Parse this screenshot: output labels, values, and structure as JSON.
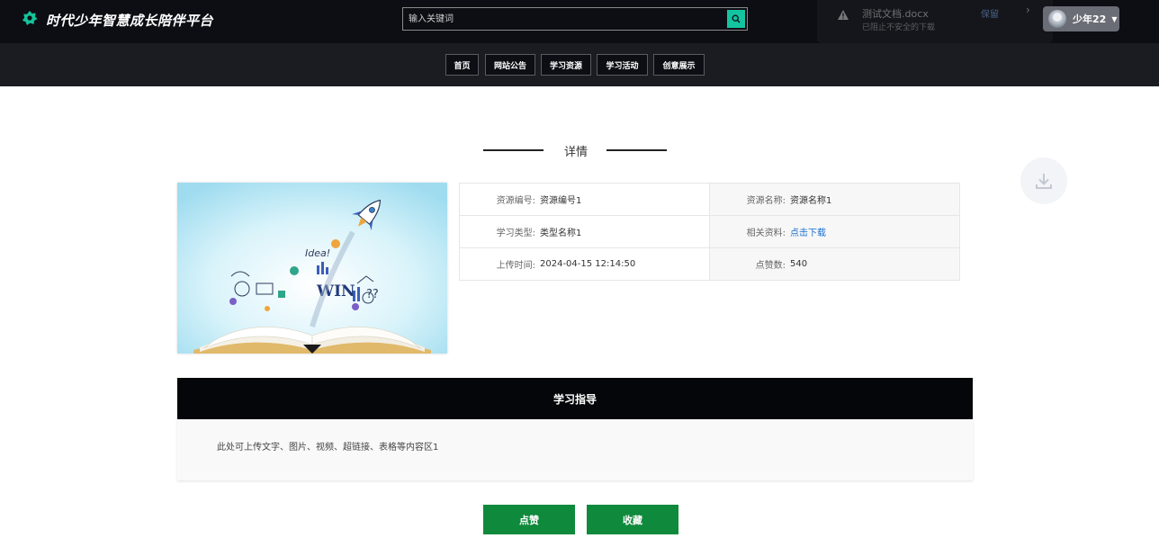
{
  "header": {
    "site_title": "时代少年智慧成长陪伴平台",
    "search_placeholder": "输入关键词",
    "user": {
      "name": "少年22"
    }
  },
  "download_popup": {
    "file_name": "测试文档.docx",
    "message": "已阻止不安全的下载",
    "keep_label": "保留",
    "arrow": "›"
  },
  "nav": {
    "items": [
      {
        "label": "首页"
      },
      {
        "label": "网站公告"
      },
      {
        "label": "学习资源"
      },
      {
        "label": "学习活动"
      },
      {
        "label": "创意展示"
      }
    ]
  },
  "detail": {
    "section_title": "详情",
    "cover_image_text": "WIN",
    "fields": {
      "resource_no_label": "资源编号:",
      "resource_no": "资源编号1",
      "resource_name_label": "资源名称:",
      "resource_name": "资源名称1",
      "study_type_label": "学习类型:",
      "study_type": "类型名称1",
      "related_label": "相关资料:",
      "related_link": "点击下载",
      "upload_time_label": "上传时间:",
      "upload_time": "2024-04-15 12:14:50",
      "likes_label": "点赞数:",
      "likes": "540"
    }
  },
  "guide": {
    "title": "学习指导",
    "content": "此处可上传文字、图片、视频、超链接、表格等内容区1"
  },
  "actions": {
    "like_label": "点赞",
    "favorite_label": "收藏"
  },
  "colors": {
    "accent_green": "#0f8a3c",
    "search_teal": "#14c3a0",
    "link_blue": "#1a6fd1"
  }
}
